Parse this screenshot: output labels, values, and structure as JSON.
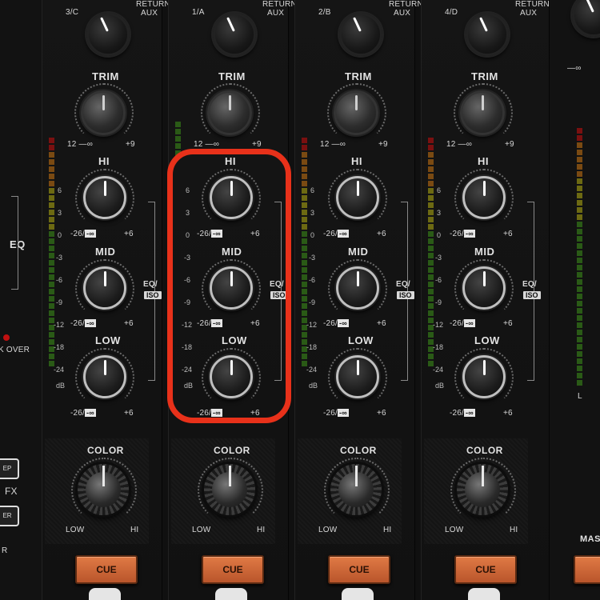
{
  "channels": [
    {
      "id": 1,
      "input_label": "3/C",
      "hi": "HI",
      "mid": "MID",
      "low": "LOW",
      "num": "1"
    },
    {
      "id": 2,
      "input_label": "1/A",
      "hi": "HI",
      "mid": "MID",
      "low": "LOW",
      "num": "2"
    },
    {
      "id": 3,
      "input_label": "2/B",
      "hi": "HI",
      "mid": "MID",
      "low": "LOW",
      "num": "3"
    },
    {
      "id": 4,
      "input_label": "4/D",
      "hi": "HI",
      "mid": "MID",
      "low": "LOW",
      "num": "4"
    }
  ],
  "labels": {
    "return_aux": "RETURN",
    "aux": "AUX",
    "trim": "TRIM",
    "trim_min": "12 —∞",
    "trim_max": "+9",
    "eq_min": "-26/",
    "eq_inf": "-∞",
    "eq_max": "+6",
    "eq_iso": "EQ/",
    "iso": "ISO",
    "color": "COLOR",
    "color_low": "LOW",
    "color_hi": "HI",
    "cue": "CUE",
    "left_eq": "EQ",
    "left_cross": "K OVER",
    "left_fx": "FX",
    "left_ep": "EP",
    "left_er": "ER",
    "left_r": "R",
    "right_minus_inf": "—∞",
    "right_master": "MAS",
    "right_l": "L"
  },
  "scale": [
    "6",
    "3",
    "0",
    "-3",
    "-6",
    "-9",
    "-12",
    "-18",
    "-24",
    "dB"
  ]
}
